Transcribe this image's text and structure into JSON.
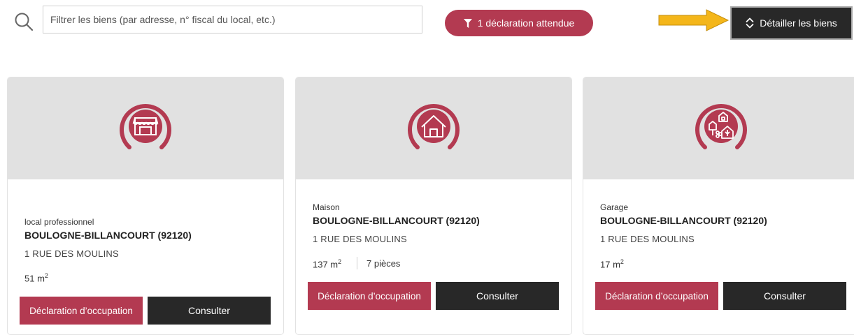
{
  "search": {
    "placeholder": "Filtrer les biens (par adresse, n° fiscal du local, etc.)",
    "icon": "search-icon"
  },
  "filter_badge": {
    "label": "1 déclaration attendue",
    "icon": "filter-icon"
  },
  "detail_button": {
    "label": "Détailler les biens",
    "icon": "expand-collapse-icon"
  },
  "colors": {
    "accent": "#b33a51",
    "dark": "#282828",
    "header_bg": "#e1e1e1",
    "arrow": "#f4b61a"
  },
  "cards": [
    {
      "icon": "shop-icon",
      "type": "local professionnel",
      "city": "BOULOGNE-BILLANCOURT (92120)",
      "street": "1 RUE DES MOULINS",
      "surface": "51 m",
      "surface_unit_sup": "2",
      "rooms": "",
      "declaration_label": "Déclaration d’occupation",
      "consult_label": "Consulter"
    },
    {
      "icon": "house-icon",
      "type": "Maison",
      "city": "BOULOGNE-BILLANCOURT (92120)",
      "street": "1 RUE DES MOULINS",
      "surface": "137 m",
      "surface_unit_sup": "2",
      "rooms": "7 pièces",
      "declaration_label": "Déclaration d’occupation",
      "consult_label": "Consulter"
    },
    {
      "icon": "garage-icon",
      "type": "Garage",
      "city": "BOULOGNE-BILLANCOURT (92120)",
      "street": "1 RUE DES MOULINS",
      "surface": "17 m",
      "surface_unit_sup": "2",
      "rooms": "",
      "declaration_label": "Déclaration d’occupation",
      "consult_label": "Consulter"
    }
  ]
}
